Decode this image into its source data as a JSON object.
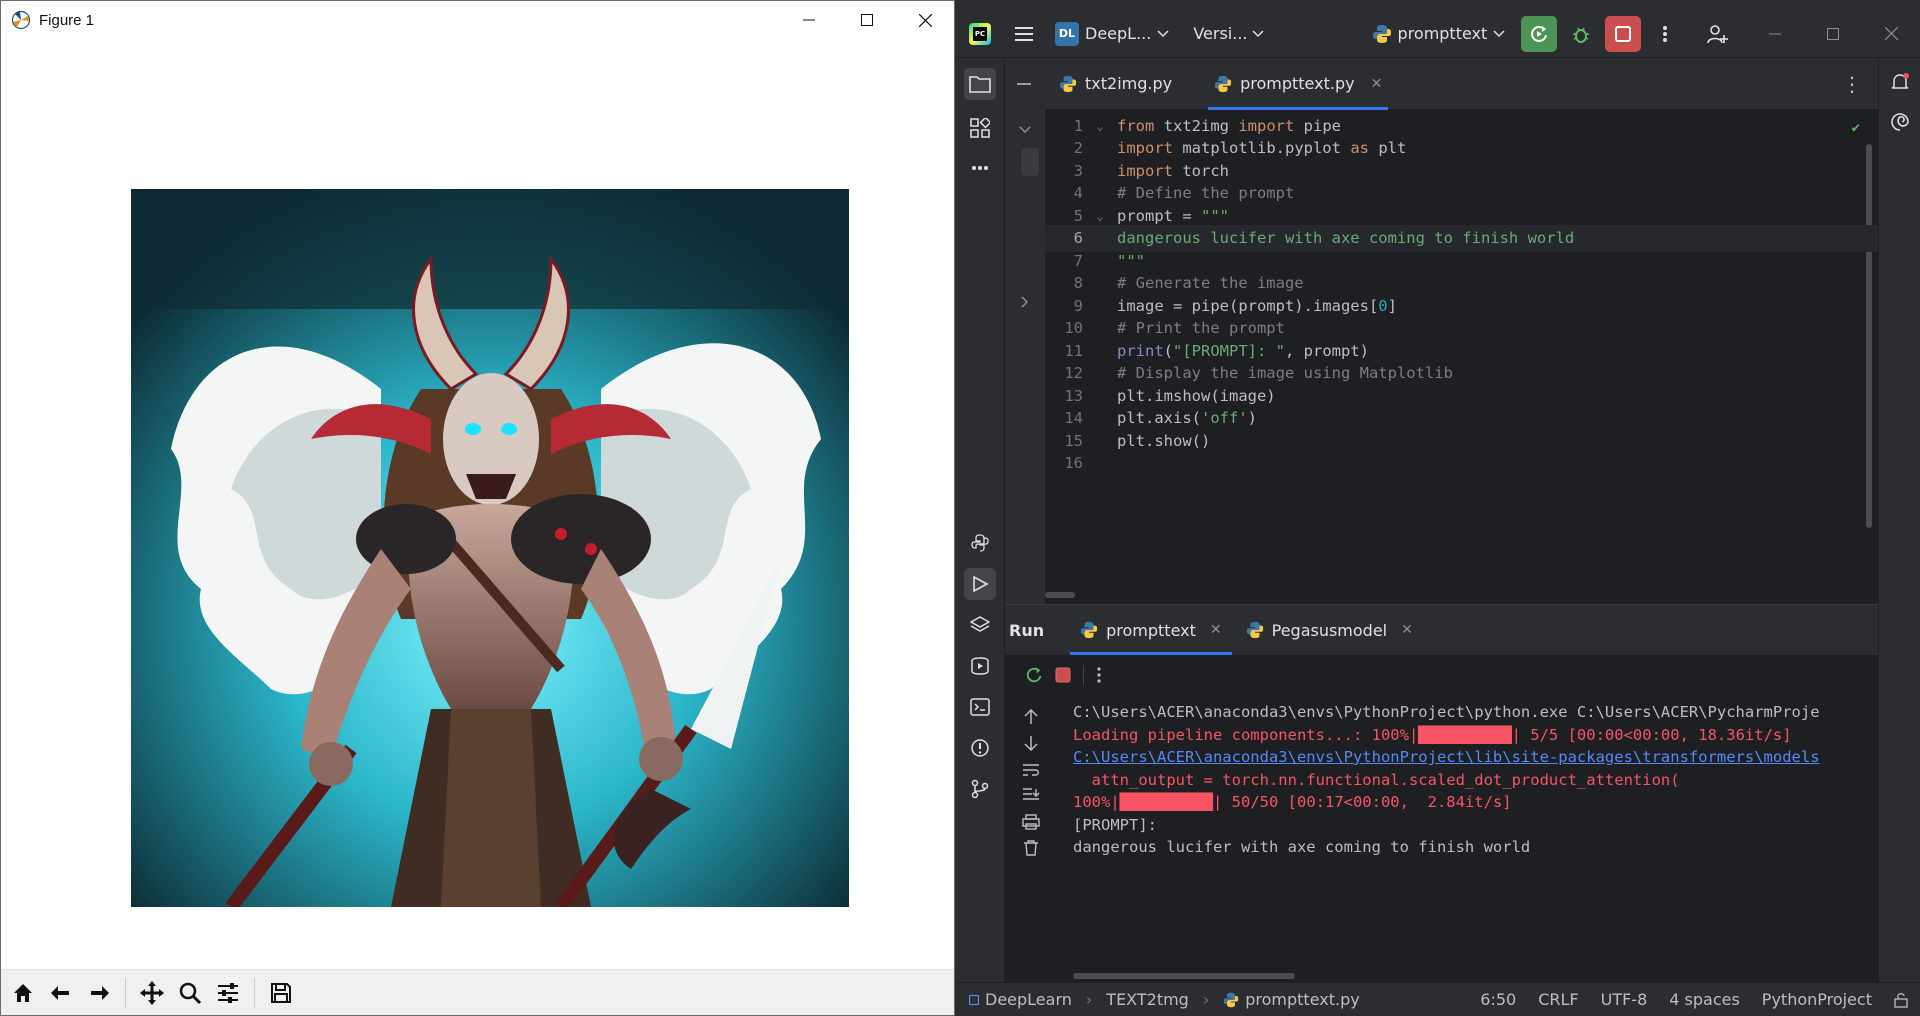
{
  "figure_window": {
    "title": "Figure 1",
    "controls": [
      "minimize",
      "maximize",
      "close"
    ],
    "image_alt": "Generated image: horned demon with white wings holding an axe",
    "toolbar": [
      "home",
      "back",
      "forward",
      "pan",
      "zoom",
      "configure-subplots",
      "save"
    ]
  },
  "ide": {
    "project_badge": "DL",
    "project_name": "DeepL...",
    "vcs_label": "Versi...",
    "run_config": "prompttext",
    "tabs": [
      {
        "label": "txt2img.py",
        "active": false
      },
      {
        "label": "prompttext.py",
        "active": true
      }
    ],
    "code_lines": [
      {
        "n": "1",
        "segments": [
          [
            "kw",
            "from"
          ],
          [
            "",
            " txt2img "
          ],
          [
            "kw",
            "import"
          ],
          [
            "",
            " pipe"
          ]
        ]
      },
      {
        "n": "2",
        "segments": [
          [
            "kw",
            "import"
          ],
          [
            "",
            " matplotlib.pyplot "
          ],
          [
            "kw",
            "as"
          ],
          [
            "",
            " plt"
          ]
        ]
      },
      {
        "n": "3",
        "segments": [
          [
            "kw",
            "import"
          ],
          [
            "",
            " torch"
          ]
        ]
      },
      {
        "n": "4",
        "segments": [
          [
            "cm",
            "# Define the prompt"
          ]
        ]
      },
      {
        "n": "5",
        "segments": [
          [
            "",
            "prompt = "
          ],
          [
            "st",
            "\"\"\""
          ]
        ]
      },
      {
        "n": "6",
        "segments": [
          [
            "st",
            "dangerous lucifer with axe coming to finish world"
          ]
        ]
      },
      {
        "n": "7",
        "segments": [
          [
            "st",
            "\"\"\""
          ]
        ]
      },
      {
        "n": "8",
        "segments": [
          [
            "cm",
            "# Generate the image"
          ]
        ]
      },
      {
        "n": "9",
        "segments": [
          [
            "",
            "image = pipe(prompt).images["
          ],
          [
            "nm",
            "0"
          ],
          [
            "",
            "]"
          ]
        ]
      },
      {
        "n": "10",
        "segments": [
          [
            "cm",
            "# Print the prompt"
          ]
        ]
      },
      {
        "n": "11",
        "segments": [
          [
            "bi",
            "print"
          ],
          [
            "",
            "("
          ],
          [
            "st",
            "\"[PROMPT]: \""
          ],
          [
            "",
            ", prompt)"
          ]
        ]
      },
      {
        "n": "12",
        "segments": [
          [
            "cm",
            "# Display the image using Matplotlib"
          ]
        ]
      },
      {
        "n": "13",
        "segments": [
          [
            "",
            "plt.imshow(image)"
          ]
        ]
      },
      {
        "n": "14",
        "segments": [
          [
            "",
            "plt.axis("
          ],
          [
            "st",
            "'off'"
          ],
          [
            "",
            ")"
          ]
        ]
      },
      {
        "n": "15",
        "segments": [
          [
            "",
            "plt.show()"
          ]
        ]
      },
      {
        "n": "16",
        "segments": []
      }
    ],
    "run_panel": {
      "label": "Run",
      "tabs": [
        {
          "label": "prompttext",
          "active": true
        },
        {
          "label": "Pegasusmodel",
          "active": false
        }
      ],
      "console": [
        {
          "style": "gray",
          "text": "C:\\Users\\ACER\\anaconda3\\envs\\PythonProject\\python.exe C:\\Users\\ACER\\PycharmProje"
        },
        {
          "style": "red",
          "pre": "Loading pipeline components...: 100%|",
          "bar": "██████████",
          "post": "| 5/5 [00:00<00:00, 18.36it/s]"
        },
        {
          "style": "link",
          "text": "C:\\Users\\ACER\\anaconda3\\envs\\PythonProject\\lib\\site-packages\\transformers\\models"
        },
        {
          "style": "red",
          "text": "  attn_output = torch.nn.functional.scaled_dot_product_attention("
        },
        {
          "style": "red",
          "pre": "100%|",
          "bar": "██████████",
          "post": "| 50/50 [00:17<00:00,  2.84it/s]"
        },
        {
          "style": "gray",
          "text": "[PROMPT]: "
        },
        {
          "style": "gray",
          "text": "dangerous lucifer with axe coming to finish world"
        }
      ]
    },
    "status": {
      "crumbs": [
        "DeepLearn",
        "TEXT2tmg",
        "prompttext.py"
      ],
      "position": "6:50",
      "line_sep": "CRLF",
      "encoding": "UTF-8",
      "indent": "4 spaces",
      "interpreter": "PythonProject"
    }
  },
  "colors": {
    "ide_bg": "#1e1f22",
    "ide_panel": "#2b2d30",
    "keyword": "#cf8e6d",
    "string": "#6aab73",
    "comment": "#7a7e85",
    "error": "#f75464",
    "link": "#548af7",
    "accent": "#3574f0"
  }
}
